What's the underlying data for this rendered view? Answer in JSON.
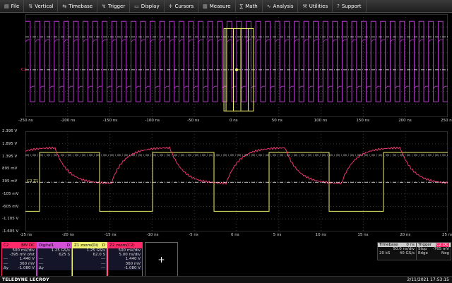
{
  "menu": [
    {
      "label": "File",
      "icon": "file-icon",
      "glyph": "▤"
    },
    {
      "label": "Vertical",
      "icon": "vertical-icon",
      "glyph": "⇅"
    },
    {
      "label": "Timebase",
      "icon": "timebase-icon",
      "glyph": "⇆"
    },
    {
      "label": "Trigger",
      "icon": "trigger-icon",
      "glyph": "↯"
    },
    {
      "label": "Display",
      "icon": "display-icon",
      "glyph": "▭"
    },
    {
      "label": "Cursors",
      "icon": "cursors-icon",
      "glyph": "✛"
    },
    {
      "label": "Measure",
      "icon": "measure-icon",
      "glyph": "▥"
    },
    {
      "label": "Math",
      "icon": "math-icon",
      "glyph": "∑"
    },
    {
      "label": "Analysis",
      "icon": "analysis-icon",
      "glyph": "∿"
    },
    {
      "label": "Utilities",
      "icon": "utilities-icon",
      "glyph": "⚒"
    },
    {
      "label": "Support",
      "icon": "support-icon",
      "glyph": "?"
    }
  ],
  "grid1": {
    "x_ticks": [
      "-250 ns",
      "-200 ns",
      "-150 ns",
      "-100 ns",
      "-50 ns",
      "0 ns",
      "50 ns",
      "100 ns",
      "150 ns",
      "200 ns",
      "250 ns"
    ],
    "channel_label": "C2"
  },
  "grid2": {
    "y_ticks": [
      "2.395 V",
      "1.895 V",
      "1.395 V",
      "895 mV",
      "395 mV",
      "-105 mV",
      "-605 mV",
      "-1.105 V",
      "-1.605 V"
    ],
    "x_ticks": [
      "-25 ns",
      "-20 ns",
      "-15 ns",
      "-10 ns",
      "-5 ns",
      "0 ns",
      "5 ns",
      "10 ns",
      "15 ns",
      "20 ns",
      "25 ns"
    ],
    "marker": "C2 Z1"
  },
  "descriptors": [
    {
      "name": "C2",
      "tags": "BW DC",
      "color": "#ff2a6a",
      "rows": [
        [
          "500 mV/div",
          ""
        ],
        [
          "-395 mV ofst",
          ""
        ],
        [
          "1.440 V",
          ""
        ],
        [
          "360 mV",
          ""
        ],
        [
          "-1.080 V",
          ""
        ]
      ],
      "left": [
        "",
        "",
        "---",
        "---",
        "Δy"
      ]
    },
    {
      "name": "Digital1",
      "tags": "D",
      "color": "#d24fd8",
      "rows": [
        [
          "1.25 GS/s",
          ""
        ],
        [
          "625 S",
          ""
        ],
        [
          "",
          ""
        ],
        [
          "",
          ""
        ],
        [
          "",
          ""
        ]
      ],
      "left": [
        "",
        "",
        "---",
        "---",
        "Δy"
      ]
    },
    {
      "name": "Z1 zoom(Di)",
      "tags": "D",
      "color": "#f0f070",
      "rows": [
        [
          "1.25 GS/s",
          ""
        ],
        [
          "62.0 S",
          ""
        ],
        [
          "---",
          ""
        ],
        [
          "---",
          ""
        ],
        [
          "---",
          ""
        ]
      ],
      "left": [
        "",
        "",
        "",
        "",
        ""
      ]
    },
    {
      "name": "Z2 zoom(C2)",
      "tags": "",
      "color": "#ff2a6a",
      "rows": [
        [
          "500 mV/div",
          ""
        ],
        [
          "5.00 ns/div",
          ""
        ],
        [
          "1.440 V",
          ""
        ],
        [
          "360 mV",
          ""
        ],
        [
          "-1.080 V",
          ""
        ]
      ],
      "left": [
        "",
        "",
        "",
        "",
        ""
      ]
    }
  ],
  "add_label": "+",
  "timebase": {
    "title": "Timebase",
    "delay": "0 ns",
    "rows": [
      [
        "50.0 ns/div",
        ""
      ],
      [
        "20 kS",
        "40 GS/s"
      ]
    ]
  },
  "trigger": {
    "title": "Trigger",
    "tags": "C2 DC",
    "rows": [
      [
        "Stop",
        "-765 mV"
      ],
      [
        "Edge",
        "Neg"
      ]
    ]
  },
  "status": {
    "brand": "TELEDYNE LECROY",
    "datetime": "2/11/2021 17:53:15"
  },
  "colors": {
    "ch2": "#ff2a6a",
    "digital": "#b43cc8",
    "zoom": "#f0f070",
    "grid": "#3a3a3a",
    "trace2": "#ff3a78"
  }
}
